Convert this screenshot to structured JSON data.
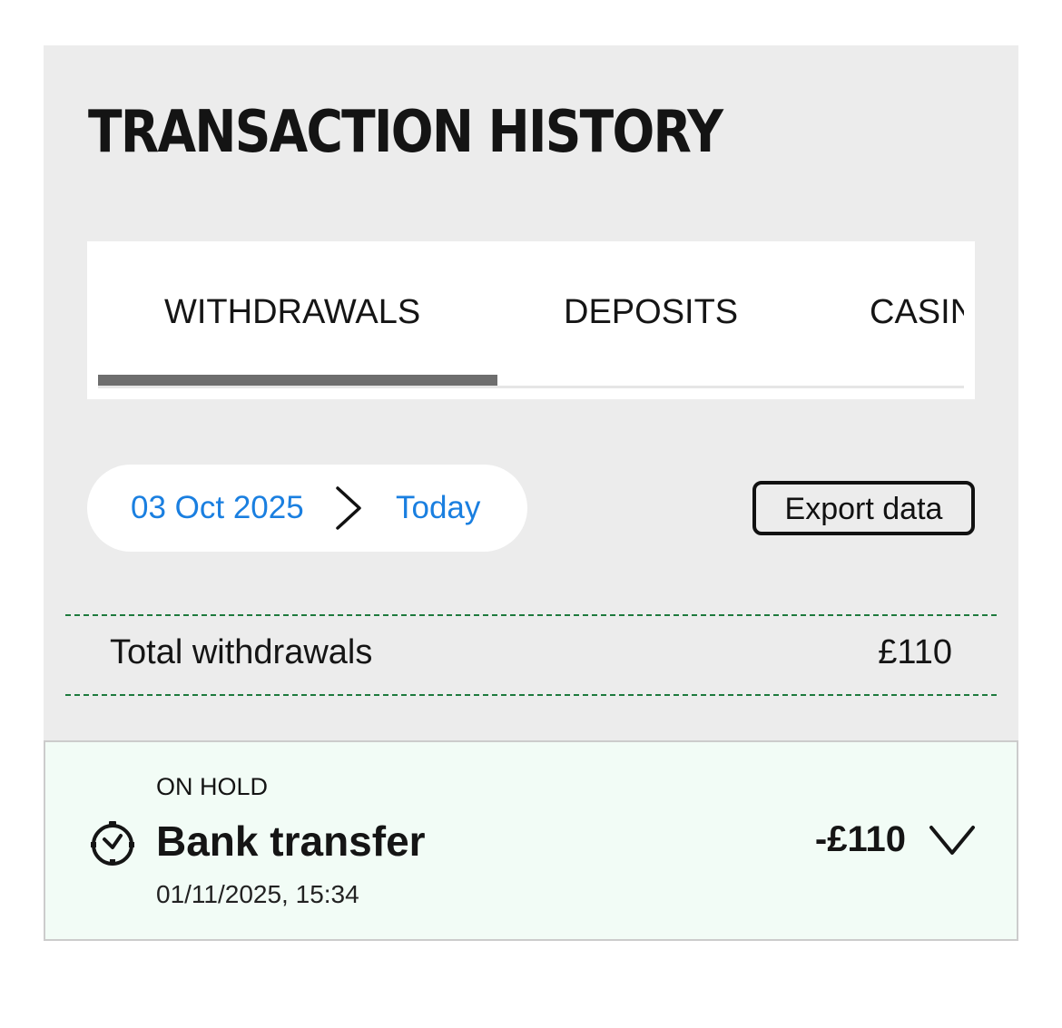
{
  "header": {
    "title": "TRANSACTION HISTORY"
  },
  "tabs": [
    {
      "label": "WITHDRAWALS",
      "active": true
    },
    {
      "label": "DEPOSITS",
      "active": false
    },
    {
      "label": "CASINO",
      "active": false
    }
  ],
  "filters": {
    "date_from": "03 Oct 2025",
    "date_to": "Today",
    "export_label": "Export data",
    "link_color": "#1a7fe0"
  },
  "summary": {
    "label": "Total withdrawals",
    "amount": "£110",
    "divider_color": "#1e7a3e"
  },
  "transactions": [
    {
      "status": "ON HOLD",
      "method": "Bank transfer",
      "datetime": "01/11/2025, 15:34",
      "amount": "-£110",
      "status_icon": "clock-icon",
      "expand_icon": "chevron-down-icon",
      "background": "#f2fcf6"
    }
  ],
  "colors": {
    "panel_background": "#ececec",
    "active_tab_indicator": "#6e6e6e"
  }
}
